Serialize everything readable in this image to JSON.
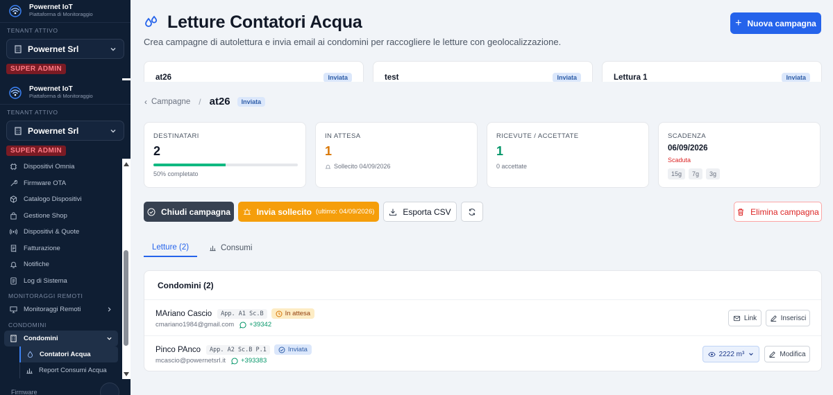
{
  "sidebar": {
    "brand_title": "Powernet IoT",
    "brand_sub": "Piattaforma di Monitoraggio",
    "tenant_section": "TENANT ATTIVO",
    "tenant_name": "Powernet Srl",
    "role_badge": "SUPER ADMIN",
    "items": [
      {
        "label": "Dispositivi Omnia",
        "icon": "chip-icon"
      },
      {
        "label": "Firmware OTA",
        "icon": "wrench-icon"
      },
      {
        "label": "Catalogo Dispositivi",
        "icon": "box-icon"
      },
      {
        "label": "Gestione Shop",
        "icon": "bag-icon"
      },
      {
        "label": "Dispositivi & Quote",
        "icon": "radio-icon"
      },
      {
        "label": "Fatturazione",
        "icon": "receipt-icon"
      },
      {
        "label": "Notifiche",
        "icon": "bell-icon"
      },
      {
        "label": "Log di Sistema",
        "icon": "log-icon"
      }
    ],
    "section_remote": "MONITORAGGI REMOTI",
    "remote_item": "Monitoraggi Remoti",
    "section_condo": "CONDOMINI",
    "condo_item": "Condomini",
    "sub_items": [
      "Contatori Acqua",
      "Report Consumi Acqua"
    ],
    "footer_label": "Firmware"
  },
  "header": {
    "title": "Letture Contatori Acqua",
    "subtitle": "Crea campagne di autolettura e invia email ai condomini per raccogliere le letture con geolocalizzazione.",
    "new_button": "Nuova campagna"
  },
  "campaigns": [
    {
      "name": "at26",
      "status": "Inviata"
    },
    {
      "name": "test",
      "status": "Inviata"
    },
    {
      "name": "Lettura 1",
      "status": "Inviata"
    }
  ],
  "breadcrumb": {
    "parent": "Campagne",
    "current": "at26",
    "status": "Inviata"
  },
  "stats": {
    "recipients": {
      "label": "DESTINATARI",
      "value": "2",
      "progress": 0.5,
      "note": "50% completato"
    },
    "pending": {
      "label": "IN ATTESA",
      "value": "1",
      "note": "Sollecito 04/09/2026"
    },
    "received": {
      "label": "RICEVUTE / ACCETTATE",
      "value": "1",
      "note": "0 accettate"
    },
    "deadline": {
      "label": "SCADENZA",
      "value": "06/09/2026",
      "note": "Scaduta",
      "pills": [
        "15g",
        "7g",
        "3g"
      ]
    }
  },
  "actions": {
    "close": "Chiudi campagna",
    "remind": "Invia sollecito",
    "remind_sub": "(ultimo: 04/09/2026)",
    "export": "Esporta CSV",
    "delete": "Elimina campagna"
  },
  "tabs": [
    {
      "label": "Letture (2)",
      "active": true
    },
    {
      "label": "Consumi",
      "active": false
    }
  ],
  "condomini": {
    "title": "Condomini (2)",
    "rows": [
      {
        "name": "MAriano Cascio",
        "apt": "App. A1 Sc.B",
        "status": "In attesa",
        "email": "cmariano1984@gmail.com",
        "phone": "+39342",
        "btn1": "Link",
        "btn2": "Inserisci"
      },
      {
        "name": "Pinco PAnco",
        "apt": "App. A2 Sc.B P.1",
        "status": "Inviata",
        "email": "mcascio@powernetsrl.it",
        "phone": "+393383",
        "reading": "2222 m³",
        "btn2": "Modifica"
      }
    ]
  },
  "colors": {
    "accent": "#2563eb",
    "warning": "#f59e0b",
    "success": "#10b981",
    "danger": "#dc2626",
    "sidebar": "#0f1e33"
  }
}
